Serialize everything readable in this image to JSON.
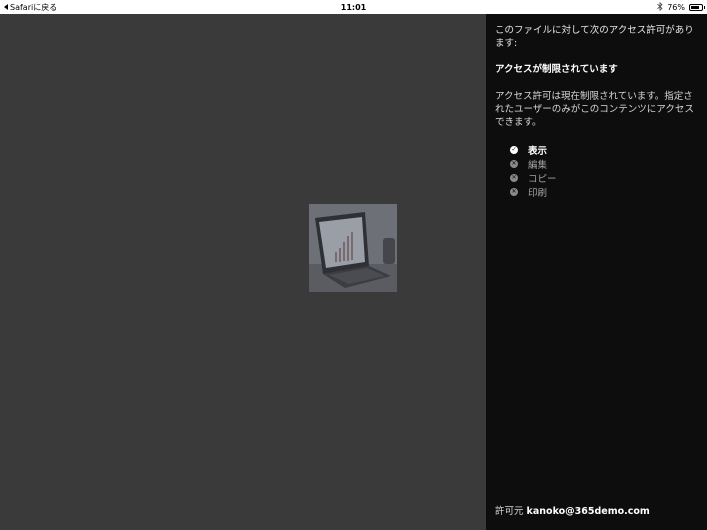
{
  "status_bar": {
    "back_label": "Safariに戻る",
    "time": "11:01",
    "battery": "76%",
    "battery_level": 0.76
  },
  "panel": {
    "intro": "このファイルに対して次のアクセス許可があります:",
    "restricted_title": "アクセスが制限されています",
    "description": "アクセス許可は現在制限されています。指定されたユーザーのみがこのコンテンツにアクセスできます。",
    "permissions": [
      {
        "label": "表示",
        "allowed": true,
        "icon": "check-icon"
      },
      {
        "label": "編集",
        "allowed": false,
        "icon": "x-icon"
      },
      {
        "label": "コピー",
        "allowed": false,
        "icon": "x-icon"
      },
      {
        "label": "印刷",
        "allowed": false,
        "icon": "x-icon"
      }
    ],
    "granted_by_label": "許可元",
    "granted_by_email": "kanoko@365demo.com"
  },
  "colors": {
    "content_bg": "#3a3a3a",
    "panel_bg": "#0d0d0d"
  }
}
